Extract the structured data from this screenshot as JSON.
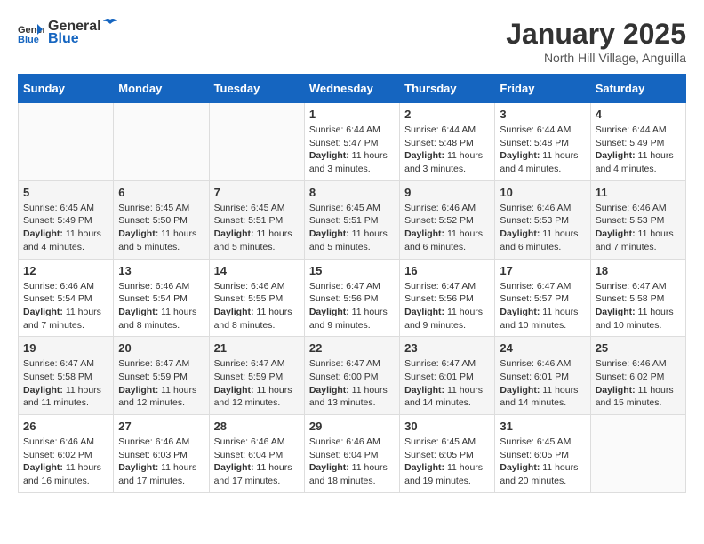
{
  "logo": {
    "general": "General",
    "blue": "Blue"
  },
  "title": "January 2025",
  "subtitle": "North Hill Village, Anguilla",
  "days": [
    "Sunday",
    "Monday",
    "Tuesday",
    "Wednesday",
    "Thursday",
    "Friday",
    "Saturday"
  ],
  "weeks": [
    [
      {
        "day": "",
        "content": ""
      },
      {
        "day": "",
        "content": ""
      },
      {
        "day": "",
        "content": ""
      },
      {
        "day": "1",
        "content": "Sunrise: 6:44 AM\nSunset: 5:47 PM\nDaylight: 11 hours and 3 minutes."
      },
      {
        "day": "2",
        "content": "Sunrise: 6:44 AM\nSunset: 5:48 PM\nDaylight: 11 hours and 3 minutes."
      },
      {
        "day": "3",
        "content": "Sunrise: 6:44 AM\nSunset: 5:48 PM\nDaylight: 11 hours and 4 minutes."
      },
      {
        "day": "4",
        "content": "Sunrise: 6:44 AM\nSunset: 5:49 PM\nDaylight: 11 hours and 4 minutes."
      }
    ],
    [
      {
        "day": "5",
        "content": "Sunrise: 6:45 AM\nSunset: 5:49 PM\nDaylight: 11 hours and 4 minutes."
      },
      {
        "day": "6",
        "content": "Sunrise: 6:45 AM\nSunset: 5:50 PM\nDaylight: 11 hours and 5 minutes."
      },
      {
        "day": "7",
        "content": "Sunrise: 6:45 AM\nSunset: 5:51 PM\nDaylight: 11 hours and 5 minutes."
      },
      {
        "day": "8",
        "content": "Sunrise: 6:45 AM\nSunset: 5:51 PM\nDaylight: 11 hours and 5 minutes."
      },
      {
        "day": "9",
        "content": "Sunrise: 6:46 AM\nSunset: 5:52 PM\nDaylight: 11 hours and 6 minutes."
      },
      {
        "day": "10",
        "content": "Sunrise: 6:46 AM\nSunset: 5:53 PM\nDaylight: 11 hours and 6 minutes."
      },
      {
        "day": "11",
        "content": "Sunrise: 6:46 AM\nSunset: 5:53 PM\nDaylight: 11 hours and 7 minutes."
      }
    ],
    [
      {
        "day": "12",
        "content": "Sunrise: 6:46 AM\nSunset: 5:54 PM\nDaylight: 11 hours and 7 minutes."
      },
      {
        "day": "13",
        "content": "Sunrise: 6:46 AM\nSunset: 5:54 PM\nDaylight: 11 hours and 8 minutes."
      },
      {
        "day": "14",
        "content": "Sunrise: 6:46 AM\nSunset: 5:55 PM\nDaylight: 11 hours and 8 minutes."
      },
      {
        "day": "15",
        "content": "Sunrise: 6:47 AM\nSunset: 5:56 PM\nDaylight: 11 hours and 9 minutes."
      },
      {
        "day": "16",
        "content": "Sunrise: 6:47 AM\nSunset: 5:56 PM\nDaylight: 11 hours and 9 minutes."
      },
      {
        "day": "17",
        "content": "Sunrise: 6:47 AM\nSunset: 5:57 PM\nDaylight: 11 hours and 10 minutes."
      },
      {
        "day": "18",
        "content": "Sunrise: 6:47 AM\nSunset: 5:58 PM\nDaylight: 11 hours and 10 minutes."
      }
    ],
    [
      {
        "day": "19",
        "content": "Sunrise: 6:47 AM\nSunset: 5:58 PM\nDaylight: 11 hours and 11 minutes."
      },
      {
        "day": "20",
        "content": "Sunrise: 6:47 AM\nSunset: 5:59 PM\nDaylight: 11 hours and 12 minutes."
      },
      {
        "day": "21",
        "content": "Sunrise: 6:47 AM\nSunset: 5:59 PM\nDaylight: 11 hours and 12 minutes."
      },
      {
        "day": "22",
        "content": "Sunrise: 6:47 AM\nSunset: 6:00 PM\nDaylight: 11 hours and 13 minutes."
      },
      {
        "day": "23",
        "content": "Sunrise: 6:47 AM\nSunset: 6:01 PM\nDaylight: 11 hours and 14 minutes."
      },
      {
        "day": "24",
        "content": "Sunrise: 6:46 AM\nSunset: 6:01 PM\nDaylight: 11 hours and 14 minutes."
      },
      {
        "day": "25",
        "content": "Sunrise: 6:46 AM\nSunset: 6:02 PM\nDaylight: 11 hours and 15 minutes."
      }
    ],
    [
      {
        "day": "26",
        "content": "Sunrise: 6:46 AM\nSunset: 6:02 PM\nDaylight: 11 hours and 16 minutes."
      },
      {
        "day": "27",
        "content": "Sunrise: 6:46 AM\nSunset: 6:03 PM\nDaylight: 11 hours and 17 minutes."
      },
      {
        "day": "28",
        "content": "Sunrise: 6:46 AM\nSunset: 6:04 PM\nDaylight: 11 hours and 17 minutes."
      },
      {
        "day": "29",
        "content": "Sunrise: 6:46 AM\nSunset: 6:04 PM\nDaylight: 11 hours and 18 minutes."
      },
      {
        "day": "30",
        "content": "Sunrise: 6:45 AM\nSunset: 6:05 PM\nDaylight: 11 hours and 19 minutes."
      },
      {
        "day": "31",
        "content": "Sunrise: 6:45 AM\nSunset: 6:05 PM\nDaylight: 11 hours and 20 minutes."
      },
      {
        "day": "",
        "content": ""
      }
    ]
  ]
}
